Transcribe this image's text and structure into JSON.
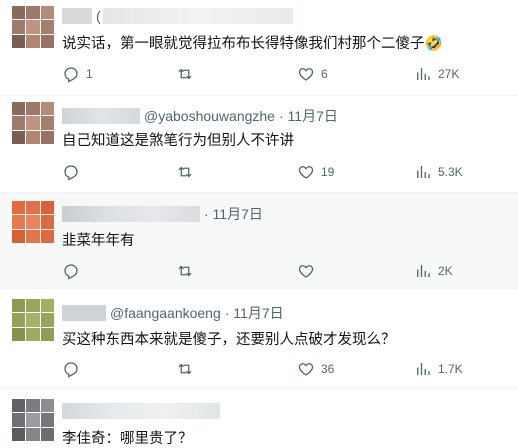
{
  "replies": [
    {
      "handle": "",
      "date": "",
      "text": "说实话，第一眼就觉得拉布布长得特像我们村那个二傻子🤣",
      "stats": {
        "reply": "1",
        "retweet": "",
        "like": "6",
        "views": "27K"
      }
    },
    {
      "handle": "@yaboshouwangzhe",
      "date": "· 11月7日",
      "text": "自己知道这是煞笔行为但别人不许讲",
      "stats": {
        "reply": "",
        "retweet": "",
        "like": "19",
        "views": "5.3K"
      }
    },
    {
      "handle": "",
      "date": "· 11月7日",
      "text": "韭菜年年有",
      "stats": {
        "reply": "",
        "retweet": "",
        "like": "",
        "views": "2K"
      }
    },
    {
      "handle": "@faangaankoeng",
      "date": "· 11月7日",
      "text": "买这种东西本来就是傻子，还要别人点破才发现么？",
      "stats": {
        "reply": "",
        "retweet": "",
        "like": "36",
        "views": "1.7K"
      }
    },
    {
      "handle": "",
      "date": "",
      "text": "李佳奇：哪里贵了？",
      "stats": {
        "reply": "",
        "retweet": "",
        "like": "",
        "views": ""
      }
    }
  ],
  "icons": {
    "reply": "reply-bubble-icon",
    "retweet": "retweet-icon",
    "like": "heart-icon",
    "views": "views-bar-icon"
  },
  "colors": {
    "text": "#0f1419",
    "secondary": "#536471",
    "border": "#eff3f4",
    "highlight_bg": "#f7f9f9",
    "avatar1": "#a0786a",
    "avatar3": "#e0714a",
    "avatar4": "#9aa75a"
  }
}
